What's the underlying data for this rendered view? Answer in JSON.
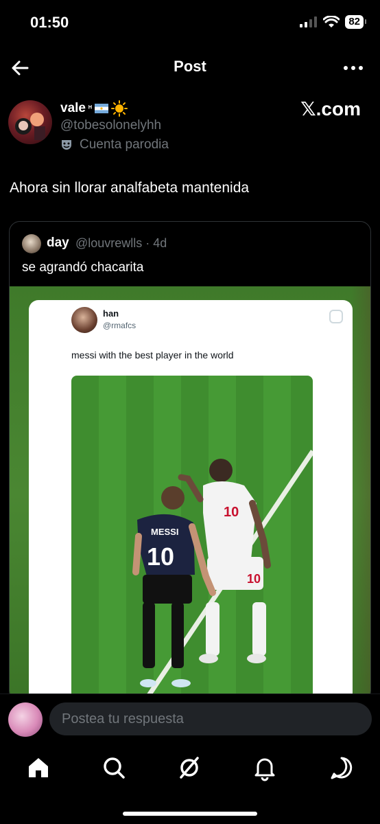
{
  "status_bar": {
    "time": "01:50",
    "battery": "82"
  },
  "header": {
    "title": "Post"
  },
  "post": {
    "author_name": "vale",
    "author_name_suffix": "ᴴ",
    "author_handle": "@tobesolonelyhh",
    "parody_label": "Cuenta parodia",
    "source_badge": "𝕏.com",
    "text": "Ahora sin llorar analfabeta mantenida"
  },
  "quote": {
    "author_name": "day",
    "author_handle": "@louvrewlls",
    "time": "4d",
    "text": "se agrandó chacarita",
    "inner": {
      "author_name": "han",
      "author_handle": "@rmafcs",
      "text": "messi with the best player in the world",
      "jersey_left_name": "MESSI",
      "jersey_left_number": "10",
      "jersey_right_number": "10"
    }
  },
  "reply": {
    "placeholder": "Postea tu respuesta"
  },
  "colors": {
    "background": "#000000",
    "muted": "#71767b",
    "pitch": "#44892f"
  },
  "tabs": [
    "home-icon",
    "search-icon",
    "grok-icon",
    "notifications-icon",
    "messages-icon"
  ]
}
